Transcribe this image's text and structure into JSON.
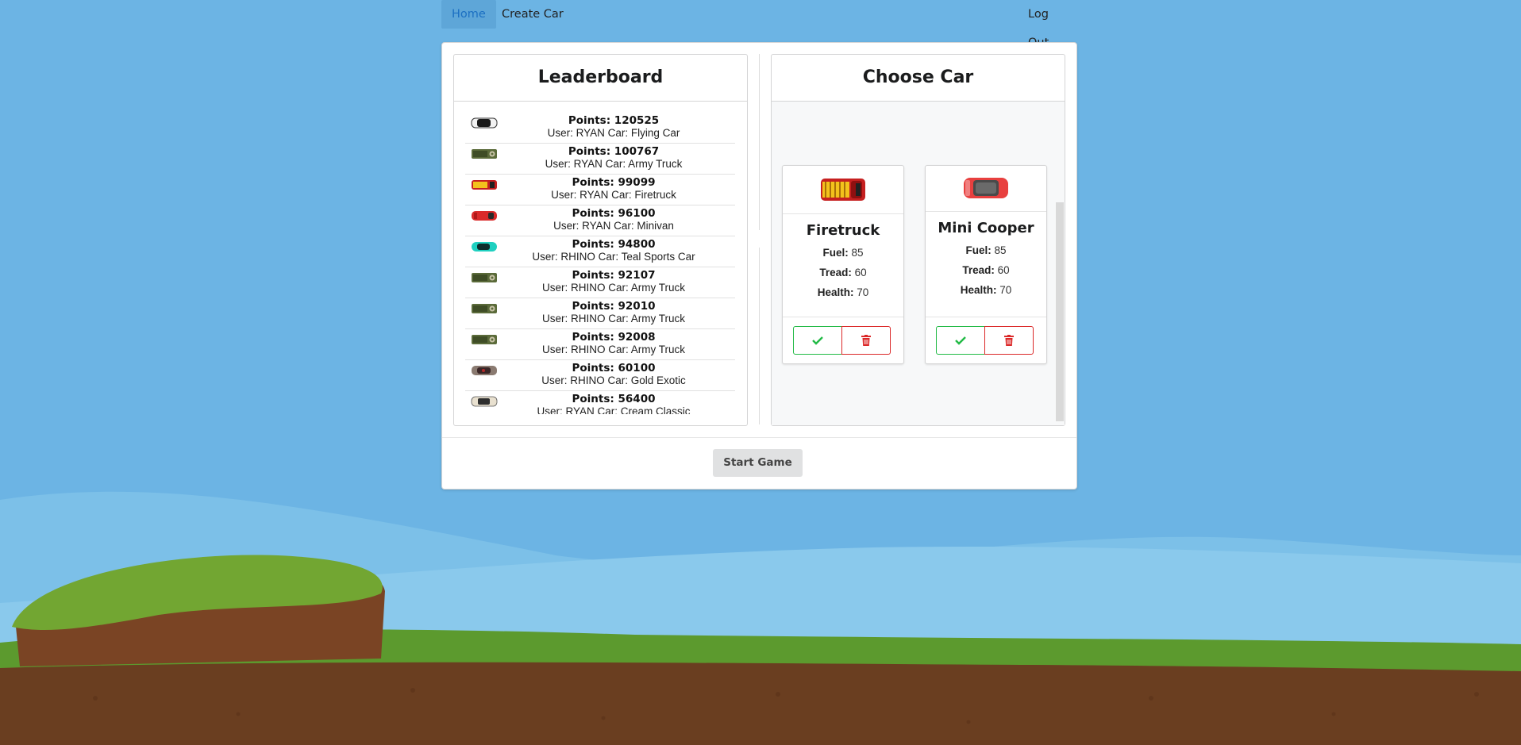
{
  "nav": {
    "home": "Home",
    "create_car": "Create Car",
    "log_out": "Log Out"
  },
  "leaderboard": {
    "title": "Leaderboard",
    "rows": [
      {
        "points": "Points: 120525",
        "detail": "User: RYAN Car: Flying Car",
        "icon": "flying-car-icon"
      },
      {
        "points": "Points: 100767",
        "detail": "User: RYAN Car: Army Truck",
        "icon": "army-truck-icon"
      },
      {
        "points": "Points: 99099",
        "detail": "User: RYAN Car: Firetruck",
        "icon": "firetruck-icon"
      },
      {
        "points": "Points: 96100",
        "detail": "User: RYAN Car: Minivan",
        "icon": "minivan-icon"
      },
      {
        "points": "Points: 94800",
        "detail": "User: RHINO Car: Teal Sports Car",
        "icon": "teal-sports-car-icon"
      },
      {
        "points": "Points: 92107",
        "detail": "User: RHINO Car: Army Truck",
        "icon": "army-truck-icon"
      },
      {
        "points": "Points: 92010",
        "detail": "User: RHINO Car: Army Truck",
        "icon": "army-truck-icon"
      },
      {
        "points": "Points: 92008",
        "detail": "User: RHINO Car: Army Truck",
        "icon": "army-truck-icon"
      },
      {
        "points": "Points: 60100",
        "detail": "User: RHINO Car: Gold Exotic",
        "icon": "gold-exotic-icon"
      },
      {
        "points": "Points: 56400",
        "detail": "User: RYAN Car: Cream Classic",
        "icon": "cream-classic-icon"
      }
    ]
  },
  "choose_car": {
    "title": "Choose Car",
    "cars": [
      {
        "name": "Firetruck",
        "fuel_label": "Fuel:",
        "fuel": "85",
        "tread_label": "Tread:",
        "tread": "60",
        "health_label": "Health:",
        "health": "70"
      },
      {
        "name": "Mini Cooper",
        "fuel_label": "Fuel:",
        "fuel": "85",
        "tread_label": "Tread:",
        "tread": "60",
        "health_label": "Health:",
        "health": "70"
      }
    ]
  },
  "start_button": "Start Game",
  "colors": {
    "sky": "#6cb4e4",
    "accent_green": "#21ba45",
    "accent_red": "#db2828",
    "nav_active": "#1b6fc2"
  }
}
